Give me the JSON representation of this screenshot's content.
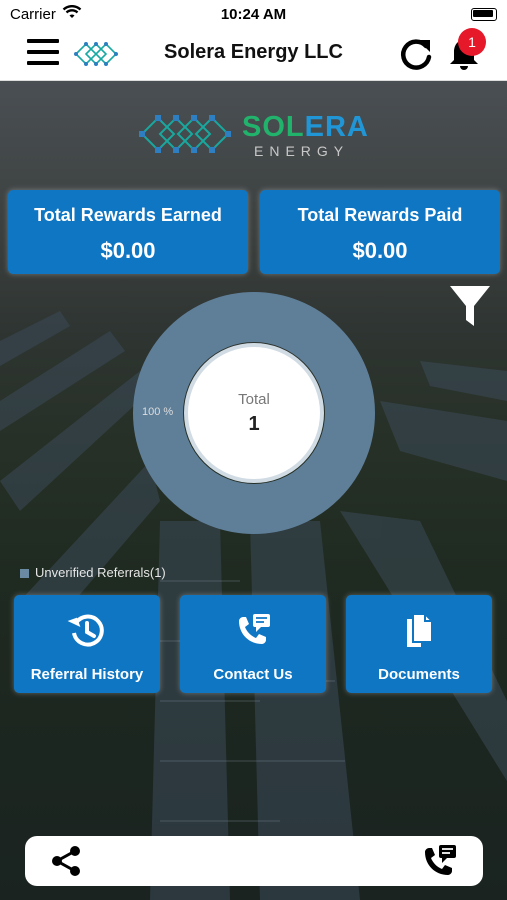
{
  "status_bar": {
    "carrier": "Carrier",
    "time": "10:24 AM"
  },
  "navbar": {
    "title": "Solera Energy LLC",
    "notification_count": "1"
  },
  "logo": {
    "sol": "SOL",
    "era": "ERA",
    "energy": "ENERGY"
  },
  "cards": [
    {
      "label": "Total Rewards Earned",
      "value": "$0.00"
    },
    {
      "label": "Total Rewards Paid",
      "value": "$0.00"
    }
  ],
  "chart_data": {
    "type": "pie",
    "categories": [
      "Unverified Referrals"
    ],
    "values": [
      1
    ],
    "center_label": "Total",
    "center_value": "1",
    "slice_label": "100 %",
    "legend": "Unverified Referrals(1)",
    "colors": [
      "#5f7f99"
    ]
  },
  "actions": [
    {
      "label": "Referral History",
      "icon": "history-icon"
    },
    {
      "label": "Contact Us",
      "icon": "phone-message-icon"
    },
    {
      "label": "Documents",
      "icon": "documents-icon"
    }
  ],
  "bottom_bar": {
    "left_icon": "share-icon",
    "right_icon": "phone-message-icon"
  }
}
